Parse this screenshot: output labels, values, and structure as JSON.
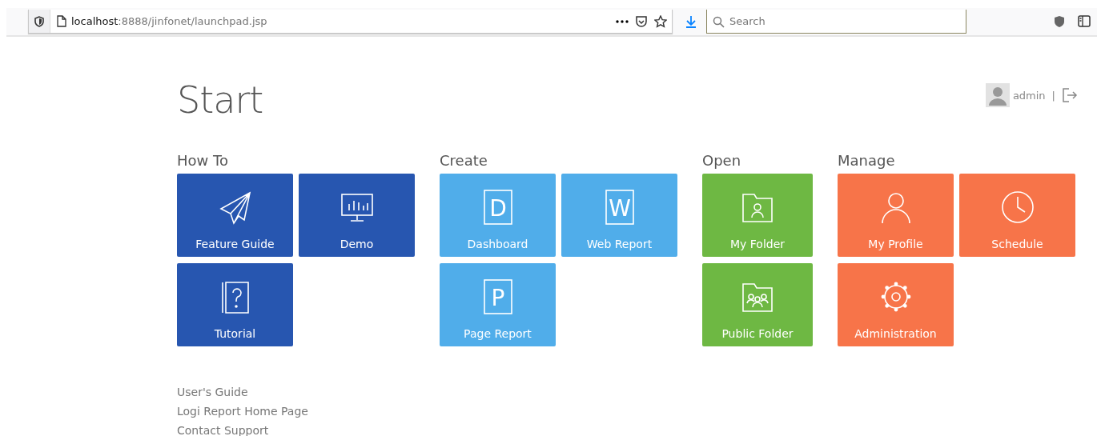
{
  "browser": {
    "url": "**localhost**:8888/jinfonet/launchpad.jsp",
    "search": {
      "placeholder": "Search"
    }
  },
  "page": {
    "title": "Start",
    "user": "admin",
    "separator": "|"
  },
  "groups": [
    {
      "title": "How To",
      "color": "#2756b0",
      "tiles": [
        {
          "label": "Feature Guide",
          "kind": "plane"
        },
        {
          "label": "Demo",
          "kind": "monitor"
        },
        {
          "label": "Tutorial",
          "kind": "book"
        }
      ]
    },
    {
      "title": "Create",
      "color": "#50adea",
      "tiles": [
        {
          "label": "Dashboard",
          "kind": "letter",
          "letter": "D"
        },
        {
          "label": "Web Report",
          "kind": "letter",
          "letter": "W"
        },
        {
          "label": "Page Report",
          "kind": "letter",
          "letter": "P"
        }
      ]
    },
    {
      "title": "Open",
      "color": "#6eb843",
      "tiles": [
        {
          "label": "My Folder",
          "kind": "folder"
        },
        {
          "label": "Public Folder",
          "kind": "folder-group"
        }
      ]
    },
    {
      "title": "Manage",
      "color": "#f77449",
      "tiles": [
        {
          "label": "My Profile",
          "kind": "person"
        },
        {
          "label": "Schedule",
          "kind": "clock"
        },
        {
          "label": "Administration",
          "kind": "gear"
        }
      ]
    }
  ],
  "links": [
    "User's Guide",
    "Logi Report Home Page",
    "Contact Support"
  ]
}
